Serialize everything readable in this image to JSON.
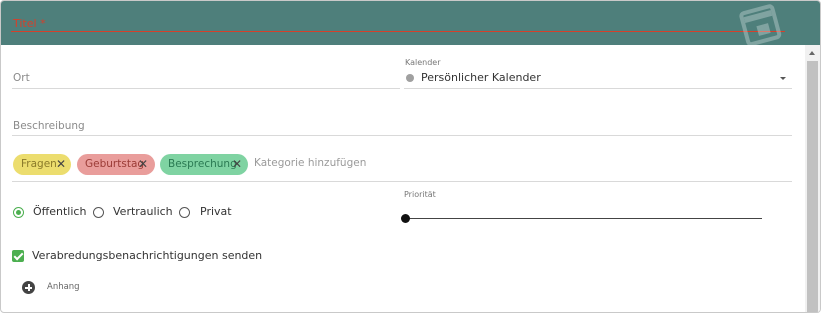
{
  "header": {
    "title_placeholder": "Titel *",
    "bg_color": "#4e7f7b",
    "accent_color": "#d5402b",
    "icon": "calendar-icon"
  },
  "form": {
    "location": {
      "placeholder": "Ort"
    },
    "calendar": {
      "label": "Kalender",
      "value": "Persönlicher Kalender",
      "color": "#a0a0a0"
    },
    "description": {
      "placeholder": "Beschreibung"
    },
    "categories": {
      "chips": [
        {
          "label": "Fragen",
          "color": "#ecdd6e"
        },
        {
          "label": "Geburtstag",
          "color": "#e99d9b"
        },
        {
          "label": "Besprechung",
          "color": "#7fd3a2"
        }
      ],
      "add_placeholder": "Kategorie hinzufügen"
    },
    "visibility": {
      "options": [
        "Öffentlich",
        "Vertraulich",
        "Privat"
      ],
      "selected": "Öffentlich"
    },
    "priority": {
      "label": "Priorität",
      "value": 0
    },
    "notifications": {
      "label": "Verabredungsbenachrichtigungen senden",
      "checked": true
    },
    "attachment": {
      "label": "Anhang"
    }
  }
}
